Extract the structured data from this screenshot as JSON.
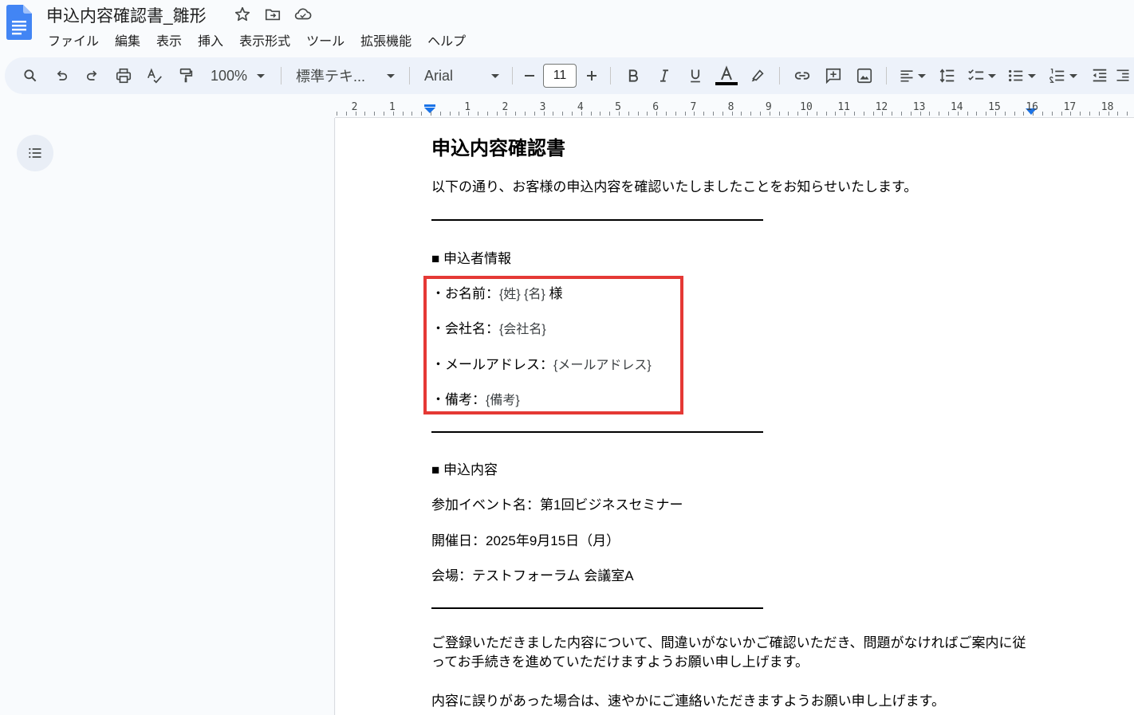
{
  "header": {
    "title": "申込内容確認書_雛形",
    "menu": [
      "ファイル",
      "編集",
      "表示",
      "挿入",
      "表示形式",
      "ツール",
      "拡張機能",
      "ヘルプ"
    ]
  },
  "toolbar": {
    "zoom": "100%",
    "style": "標準テキ...",
    "font": "Arial",
    "font_size": "11"
  },
  "ruler": {
    "labels": [
      "2",
      "1",
      "1",
      "2",
      "3",
      "4",
      "5",
      "6",
      "7",
      "8",
      "9",
      "10",
      "11",
      "12",
      "13",
      "14",
      "15",
      "16",
      "17",
      "18"
    ]
  },
  "document": {
    "title": "申込内容確認書",
    "intro": "以下の通り、お客様の申込内容を確認いたしましたことをお知らせいたします。",
    "section1_heading": "■ 申込者情報",
    "name_label": "・お名前：",
    "name_value": "{姓} {名}",
    "name_suffix": " 様",
    "company_label": "・会社名：",
    "company_value": "{会社名}",
    "email_label": "・メールアドレス：",
    "email_value": "{メールアドレス}",
    "note_label": "・備考：",
    "note_value": "{備考}",
    "section2_heading": "■ 申込内容",
    "event": "参加イベント名：第1回ビジネスセミナー",
    "date": "開催日：2025年9月15日（月）",
    "venue": "会場：テストフォーラム 会議室A",
    "closing1": "ご登録いただきました内容について、間違いがないかご確認いただき、問題がなければご案内に従ってお手続きを進めていただけますようお願い申し上げます。",
    "closing2": "内容に誤りがあった場合は、速やかにご連絡いただきますようお願い申し上げます。"
  },
  "colors": {
    "highlight_border": "#e53935",
    "docs_blue": "#4285f4"
  }
}
